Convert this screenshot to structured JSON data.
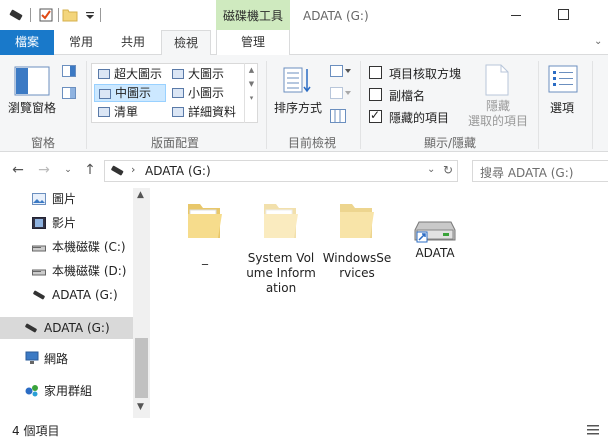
{
  "titlebar": {
    "context_tab": "磁碟機工具",
    "title": "ADATA (G:)"
  },
  "tabs": {
    "file": "檔案",
    "home": "常用",
    "share": "共用",
    "view": "檢視",
    "manage": "管理"
  },
  "ribbon": {
    "panes": {
      "nav_pane": "瀏覽窗格",
      "label": "窗格"
    },
    "layout": {
      "items": [
        "超大圖示",
        "大圖示",
        "中圖示",
        "小圖示",
        "清單",
        "詳細資料"
      ],
      "label": "版面配置"
    },
    "current_view": {
      "sort_by": "排序方式",
      "label": "目前檢視"
    },
    "show_hide": {
      "item_checkboxes": "項目核取方塊",
      "file_extensions": "副檔名",
      "hidden_items": "隱藏的項目",
      "hide_selected_1": "隱藏",
      "hide_selected_2": "選取的項目",
      "label": "顯示/隱藏"
    },
    "options": "選項"
  },
  "address": {
    "path": "ADATA (G:)",
    "search_placeholder": "搜尋 ADATA (G:)"
  },
  "navpane": {
    "items": [
      "圖片",
      "影片",
      "本機磁碟 (C:)",
      "本機磁碟 (D:)",
      "ADATA (G:)",
      "ADATA (G:)",
      "網路",
      "家用群組"
    ]
  },
  "files": [
    {
      "name": "_"
    },
    {
      "name": "System Volume Information"
    },
    {
      "name": "WindowsServices"
    },
    {
      "name": "ADATA"
    }
  ],
  "status": {
    "count": "4 個項目"
  }
}
